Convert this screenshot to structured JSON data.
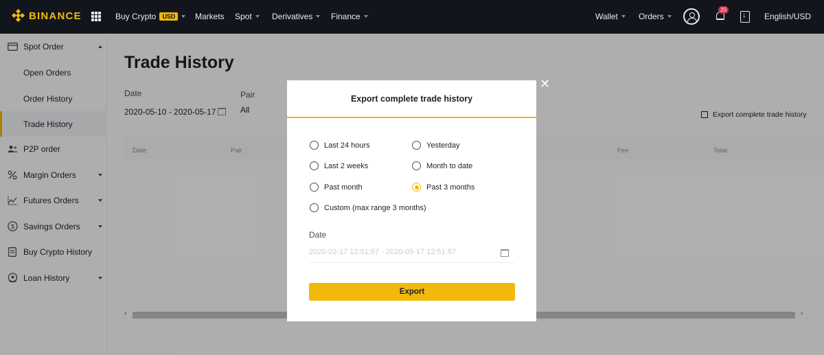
{
  "nav": {
    "brand": "BINANCE",
    "buy_crypto": "Buy Crypto",
    "buy_crypto_badge": "USD",
    "markets": "Markets",
    "spot": "Spot",
    "derivatives": "Derivatives",
    "finance": "Finance",
    "wallet": "Wallet",
    "orders": "Orders",
    "notification_count": "20",
    "language": "English/USD"
  },
  "sidebar": {
    "items": [
      {
        "label": "Spot Order",
        "icon": "wallet-icon",
        "expanded": true
      },
      {
        "label": "Open Orders"
      },
      {
        "label": "Order History"
      },
      {
        "label": "Trade History",
        "active": true
      },
      {
        "label": "P2P order",
        "icon": "people-icon"
      },
      {
        "label": "Margin Orders",
        "icon": "percent-icon"
      },
      {
        "label": "Futures Orders",
        "icon": "futures-icon"
      },
      {
        "label": "Savings Orders",
        "icon": "savings-icon"
      },
      {
        "label": "Buy Crypto History",
        "icon": "document-icon"
      },
      {
        "label": "Loan History",
        "icon": "loan-icon"
      }
    ]
  },
  "main": {
    "title": "Trade History",
    "date_label": "Date",
    "date_value": "2020-05-10 - 2020-05-17",
    "pair_label": "Pair",
    "pair_value": "All",
    "export_link": "Export complete trade history",
    "columns": [
      "Date",
      "Pair",
      "Fee",
      "Total"
    ]
  },
  "modal": {
    "title": "Export complete trade history",
    "options": [
      {
        "label": "Last 24 hours",
        "checked": false
      },
      {
        "label": "Yesterday",
        "checked": false
      },
      {
        "label": "Last 2 weeks",
        "checked": false
      },
      {
        "label": "Month to date",
        "checked": false
      },
      {
        "label": "Past month",
        "checked": false
      },
      {
        "label": "Past 3 months",
        "checked": true
      },
      {
        "label": "Custom (max range 3 months)",
        "checked": false
      }
    ],
    "date_label": "Date",
    "date_range": "2020-02-17 12:51:57 - 2020-05-17 12:51:57",
    "export_button": "Export"
  },
  "colors": {
    "brand": "#f0b90b",
    "nav_bg": "#12161c",
    "badge": "#cf304a"
  }
}
